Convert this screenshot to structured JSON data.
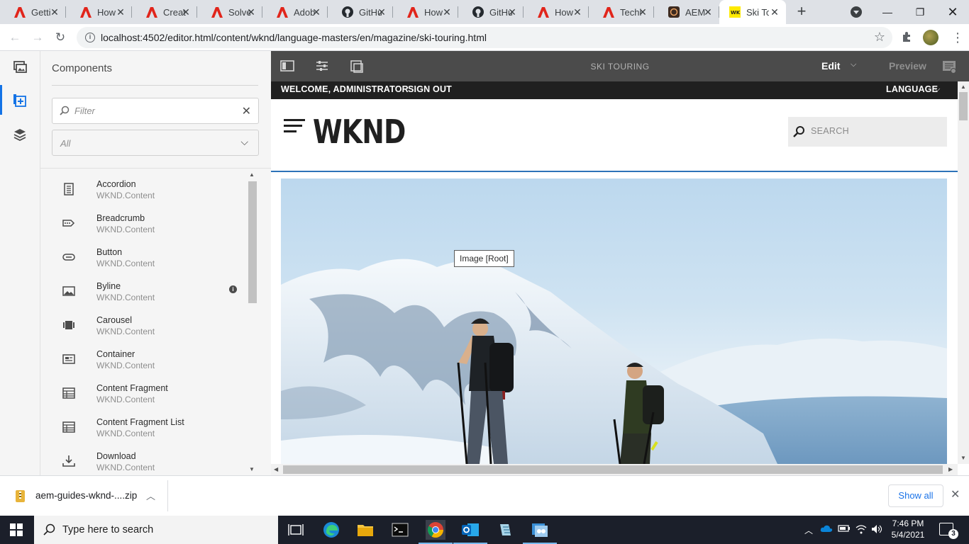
{
  "browser": {
    "tabs": [
      {
        "title": "Getti",
        "icon": "adobe-icon"
      },
      {
        "title": "How",
        "icon": "adobe-icon"
      },
      {
        "title": "Creat",
        "icon": "adobe-icon"
      },
      {
        "title": "Solve",
        "icon": "adobe-icon"
      },
      {
        "title": "Adob",
        "icon": "adobe-icon"
      },
      {
        "title": "GitHu",
        "icon": "github-icon"
      },
      {
        "title": "How",
        "icon": "adobe-icon"
      },
      {
        "title": "GitHu",
        "icon": "github-icon"
      },
      {
        "title": "How",
        "icon": "adobe-icon"
      },
      {
        "title": "Techi",
        "icon": "adobe-icon"
      },
      {
        "title": "AEM",
        "icon": "aem-icon"
      },
      {
        "title": "Ski To",
        "icon": "wknd-icon"
      }
    ],
    "active_tab_index": 11,
    "url": "localhost:4502/editor.html/content/wknd/language-masters/en/magazine/ski-touring.html"
  },
  "sidepanel": {
    "title": "Components",
    "filter_placeholder": "Filter",
    "group_value": "All",
    "components": [
      {
        "name": "Accordion",
        "group": "WKND.Content",
        "icon": "accordion-icon"
      },
      {
        "name": "Breadcrumb",
        "group": "WKND.Content",
        "icon": "breadcrumb-icon"
      },
      {
        "name": "Button",
        "group": "WKND.Content",
        "icon": "button-icon"
      },
      {
        "name": "Byline",
        "group": "WKND.Content",
        "icon": "image-icon",
        "has_info": true
      },
      {
        "name": "Carousel",
        "group": "WKND.Content",
        "icon": "carousel-icon"
      },
      {
        "name": "Container",
        "group": "WKND.Content",
        "icon": "container-icon"
      },
      {
        "name": "Content Fragment",
        "group": "WKND.Content",
        "icon": "table-icon"
      },
      {
        "name": "Content Fragment List",
        "group": "WKND.Content",
        "icon": "table-icon"
      },
      {
        "name": "Download",
        "group": "WKND.Content",
        "icon": "download-icon"
      }
    ]
  },
  "editor": {
    "page_title": "SKI TOURING",
    "mode": "Edit",
    "preview_label": "Preview"
  },
  "site": {
    "welcome": "WELCOME, ADMINISTRATOR",
    "sign_out": "SIGN OUT",
    "language": "LANGUAGE",
    "logo": "WKND",
    "search_placeholder": "SEARCH",
    "image_tooltip": "Image [Root]",
    "accent": "#2d72b8"
  },
  "downloads": {
    "file": "aem-guides-wknd-....zip",
    "show_all": "Show all"
  },
  "taskbar": {
    "search_text": "Type here to search",
    "time": "7:46 PM",
    "date": "5/4/2021",
    "notifications": "3"
  }
}
